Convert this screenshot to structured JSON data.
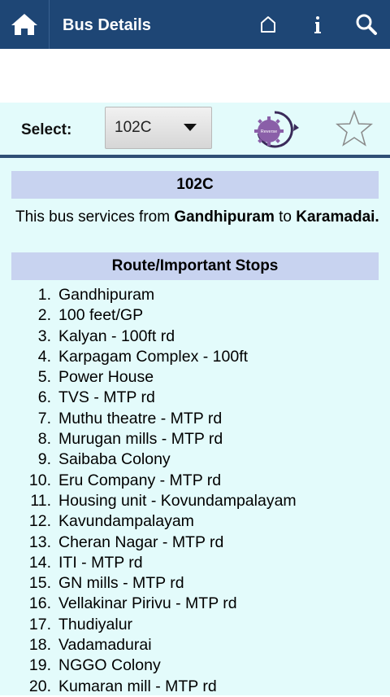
{
  "header": {
    "title": "Bus Details",
    "icons": [
      "home-icon",
      "house-outline-icon",
      "info-icon",
      "search-icon"
    ]
  },
  "toolbar": {
    "select_label": "Select:",
    "selected_route": "102C",
    "reverse_label": "Reverse",
    "favorite_icon": "star-outline-icon"
  },
  "details": {
    "route_heading": "102C",
    "desc_prefix": "This bus services from ",
    "from": "Gandhipuram",
    "desc_mid": " to ",
    "to": "Karamadai.",
    "stops_heading": "Route/Important Stops",
    "stops": [
      {
        "num": "1.",
        "name": "Gandhipuram"
      },
      {
        "num": "2.",
        "name": "100 feet/GP"
      },
      {
        "num": "3.",
        "name": "Kalyan - 100ft rd"
      },
      {
        "num": "4.",
        "name": "Karpagam Complex - 100ft"
      },
      {
        "num": "5.",
        "name": "Power House"
      },
      {
        "num": "6.",
        "name": "TVS - MTP rd"
      },
      {
        "num": "7.",
        "name": "Muthu theatre - MTP rd"
      },
      {
        "num": "8.",
        "name": "Murugan mills - MTP rd"
      },
      {
        "num": "9.",
        "name": "Saibaba Colony"
      },
      {
        "num": "10.",
        "name": "Eru Company - MTP rd"
      },
      {
        "num": "11.",
        "name": "Housing unit - Kovundampalayam"
      },
      {
        "num": "12.",
        "name": "Kavundampalayam"
      },
      {
        "num": "13.",
        "name": "Cheran Nagar - MTP rd"
      },
      {
        "num": "14.",
        "name": "ITI - MTP rd"
      },
      {
        "num": "15.",
        "name": "GN mills - MTP rd"
      },
      {
        "num": "16.",
        "name": "Vellakinar Pirivu - MTP rd"
      },
      {
        "num": "17.",
        "name": "Thudiyalur"
      },
      {
        "num": "18.",
        "name": "Vadamadurai"
      },
      {
        "num": "19.",
        "name": "NGGO Colony"
      },
      {
        "num": "20.",
        "name": "Kumaran mill - MTP rd"
      }
    ]
  },
  "colors": {
    "appbar": "#1e4675",
    "content_bg": "#e3fbfb",
    "band": "#c8d3f0",
    "reverse_badge": "#8a5fa8"
  }
}
